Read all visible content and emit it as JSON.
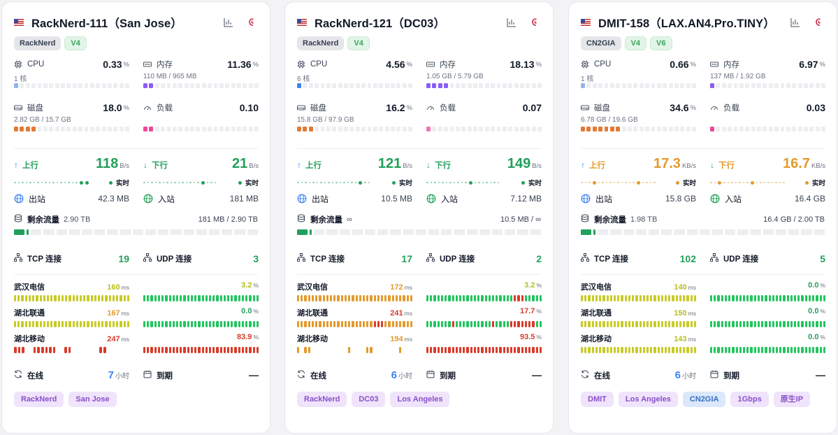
{
  "colors": {
    "green": "#22a05a",
    "orange": "#e39a2c",
    "red": "#d93b2b",
    "yellow": "#c8cb24",
    "blue": "#3b82f6"
  },
  "labels": {
    "cpu": "CPU",
    "mem": "内存",
    "disk": "磁盘",
    "load": "负载",
    "up": "上行",
    "down": "下行",
    "realtime": "实时",
    "out": "出站",
    "in": "入站",
    "quota": "剩余流量",
    "tcp": "TCP 连接",
    "udp": "UDP 连接",
    "online": "在线",
    "expire": "到期",
    "hours": "小时",
    "pct": "%",
    "ms": "ms"
  },
  "servers": [
    {
      "title": "RackNerd-111（San Jose）",
      "tags": [
        "RackNerd",
        "V4"
      ],
      "cpu": {
        "value": "0.33",
        "sub": "1 核",
        "fill": 0.0033,
        "color": "#93b4ea"
      },
      "mem": {
        "value": "11.36",
        "sub": "110 MB / 965 MB",
        "fill": 0.1136,
        "color": "#8b5cf6"
      },
      "disk": {
        "value": "18.0",
        "sub": "2.82 GB / 15.7 GB",
        "fill": 0.18,
        "color": "#e07a35"
      },
      "load": {
        "value": "0.10",
        "fill": 0.1,
        "color": "#ec4899"
      },
      "up": {
        "value": "118",
        "unit": "B/s"
      },
      "down": {
        "value": "21",
        "unit": "B/s"
      },
      "net_color": "#22a05a",
      "out": "42.3 MB",
      "in": "181 MB",
      "quota": {
        "total": "2.90 TB",
        "used": "181 MB / 2.90 TB",
        "fill": 0.0
      },
      "tcp": "19",
      "udp": "3",
      "pings": [
        {
          "name": "武汉电信",
          "latency": "160",
          "latency_color": "#b5bf1f",
          "loss": "3.2",
          "loss_color": "#b5bf1f"
        },
        {
          "name": "湖北联通",
          "latency": "167",
          "latency_color": "#e39a2c",
          "loss": "0.0",
          "loss_color": "#22a05a"
        },
        {
          "name": "湖北移动",
          "latency": "247",
          "latency_color": "#d93b2b",
          "loss": "83.9",
          "loss_color": "#d93b2b"
        }
      ],
      "online": "7",
      "expire": "—",
      "bottom_tags": [
        {
          "label": "RackNerd",
          "style": "purple"
        },
        {
          "label": "San Jose",
          "style": "purple"
        }
      ]
    },
    {
      "title": "RackNerd-121（DC03）",
      "tags": [
        "RackNerd",
        "V4"
      ],
      "cpu": {
        "value": "4.56",
        "sub": "6 核",
        "fill": 0.0456,
        "color": "#3b82f6"
      },
      "mem": {
        "value": "18.13",
        "sub": "1.05 GB / 5.79 GB",
        "fill": 0.1813,
        "color": "#8b5cf6"
      },
      "disk": {
        "value": "16.2",
        "sub": "15.8 GB / 97.9 GB",
        "fill": 0.162,
        "color": "#e07a35"
      },
      "load": {
        "value": "0.07",
        "fill": 0.07,
        "color": "#f472b6"
      },
      "up": {
        "value": "121",
        "unit": "B/s"
      },
      "down": {
        "value": "149",
        "unit": "B/s"
      },
      "net_color": "#22a05a",
      "out": "10.5 MB",
      "in": "7.12 MB",
      "quota": {
        "total": "∞",
        "used": "10.5 MB / ∞",
        "fill": 0.0
      },
      "tcp": "17",
      "udp": "2",
      "pings": [
        {
          "name": "武汉电信",
          "latency": "172",
          "latency_color": "#e39a2c",
          "loss": "3.2",
          "loss_color": "#b5bf1f"
        },
        {
          "name": "湖北联通",
          "latency": "241",
          "latency_color": "#d93b2b",
          "loss": "17.7",
          "loss_color": "#d93b2b"
        },
        {
          "name": "湖北移动",
          "latency": "194",
          "latency_color": "#e39a2c",
          "loss": "93.5",
          "loss_color": "#d93b2b"
        }
      ],
      "online": "6",
      "expire": "—",
      "bottom_tags": [
        {
          "label": "RackNerd",
          "style": "purple"
        },
        {
          "label": "DC03",
          "style": "purple"
        },
        {
          "label": "Los Angeles",
          "style": "purple"
        }
      ]
    },
    {
      "title": "DMIT-158（LAX.AN4.Pro.TINY）",
      "tags": [
        "CN2GIA",
        "V4",
        "V6"
      ],
      "cpu": {
        "value": "0.66",
        "sub": "1 核",
        "fill": 0.0066,
        "color": "#93b4ea"
      },
      "mem": {
        "value": "6.97",
        "sub": "137 MB / 1.92 GB",
        "fill": 0.0697,
        "color": "#8b5cf6"
      },
      "disk": {
        "value": "34.6",
        "sub": "6.78 GB / 19.6 GB",
        "fill": 0.346,
        "color": "#e07a35"
      },
      "load": {
        "value": "0.03",
        "fill": 0.03,
        "color": "#ec4899"
      },
      "up": {
        "value": "17.3",
        "unit": "KB/s"
      },
      "down": {
        "value": "16.7",
        "unit": "KB/s"
      },
      "net_color": "#e39a2c",
      "out": "15.8 GB",
      "in": "16.4 GB",
      "quota": {
        "total": "1.98 TB",
        "used": "16.4 GB / 2.00 TB",
        "fill": 0.0082
      },
      "tcp": "102",
      "udp": "5",
      "pings": [
        {
          "name": "武汉电信",
          "latency": "140",
          "latency_color": "#b5bf1f",
          "loss": "0.0",
          "loss_color": "#22a05a"
        },
        {
          "name": "湖北联通",
          "latency": "150",
          "latency_color": "#b5bf1f",
          "loss": "0.0",
          "loss_color": "#22a05a"
        },
        {
          "name": "湖北移动",
          "latency": "143",
          "latency_color": "#b5bf1f",
          "loss": "0.0",
          "loss_color": "#22a05a"
        }
      ],
      "online": "6",
      "expire": "—",
      "bottom_tags": [
        {
          "label": "DMIT",
          "style": "purple"
        },
        {
          "label": "Los Angeles",
          "style": "purple"
        },
        {
          "label": "CN2GIA",
          "style": "blue"
        },
        {
          "label": "1Gbps",
          "style": "purple"
        },
        {
          "label": "原生IP",
          "style": "purple"
        }
      ]
    }
  ]
}
